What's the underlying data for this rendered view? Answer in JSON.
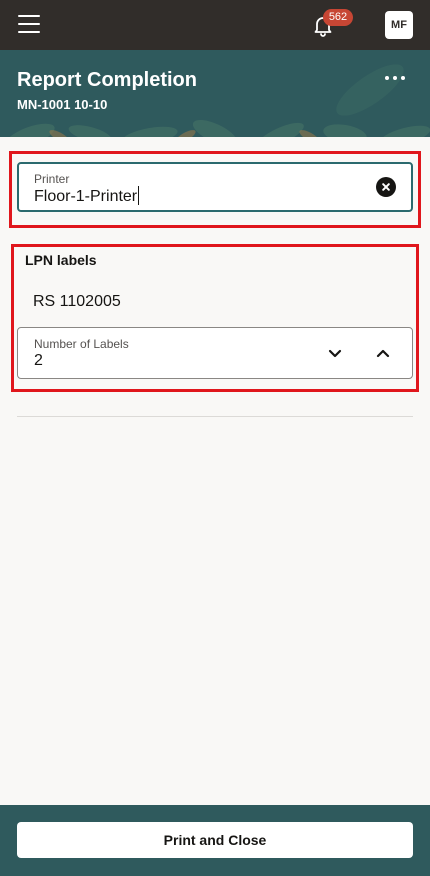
{
  "topbar": {
    "menu_icon": "hamburger-menu-icon",
    "notification_icon": "bell-icon",
    "notification_count": "562",
    "user_initials": "MF"
  },
  "header": {
    "title": "Report Completion",
    "subtitle": "MN-1001 10-10",
    "more_icon": "more-horizontal-icon"
  },
  "printer": {
    "label": "Printer",
    "value": "Floor-1-Printer",
    "clear_icon": "clear-circle-icon"
  },
  "lpn": {
    "section_title": "LPN labels",
    "lpn_value": "RS 1102005",
    "number_label": "Number of Labels",
    "number_value": "2",
    "decrement_icon": "chevron-down-icon",
    "increment_icon": "chevron-up-icon"
  },
  "footer": {
    "print_label": "Print and Close"
  },
  "colors": {
    "topbar": "#312d2a",
    "header": "#2f5a5d",
    "badge": "#c74634",
    "highlight": "#e0161c",
    "focus_border": "#2b6a6e"
  }
}
